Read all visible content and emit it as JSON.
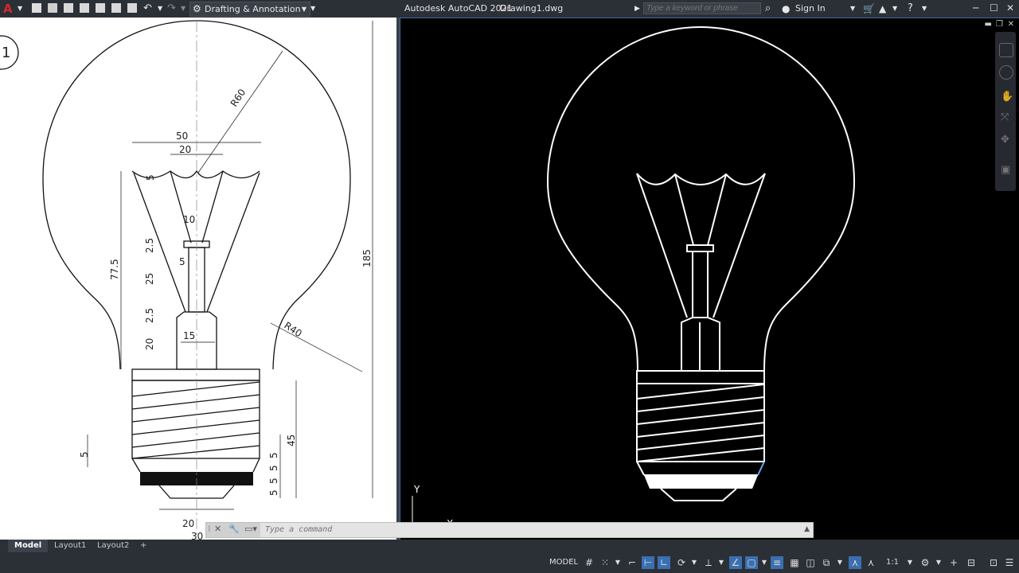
{
  "titlebar": {
    "app_title": "Autodesk AutoCAD 2021",
    "document_name": "Drawing1.dwg",
    "workspace": "Drafting & Annotation",
    "search_placeholder": "Type a keyword or phrase",
    "sign_in": "Sign In"
  },
  "reference_drawing": {
    "number": "1",
    "dims": [
      "R60",
      "50",
      "20",
      "5",
      "10",
      "2.5",
      "5",
      "77.5",
      "25",
      "2.5",
      "15",
      "20",
      "185",
      "R40",
      "45",
      "5",
      "5",
      "5",
      "5",
      "5",
      "20",
      "30"
    ]
  },
  "viewport": {
    "ucs_y": "Y",
    "ucs_x": "X"
  },
  "command_line": {
    "placeholder": "Type a command"
  },
  "layout_tabs": [
    "Model",
    "Layout1",
    "Layout2"
  ],
  "status": {
    "model": "MODEL",
    "scale": "1:1"
  },
  "colors": {
    "titlebar_bg": "#2b2f36",
    "accent_blue": "#3a6ea8",
    "drawing_line": "#ffffff",
    "canvas_bg": "#000000"
  },
  "icons": [
    "autocad-logo-icon",
    "new-icon",
    "open-icon",
    "save-icon",
    "saveas-icon",
    "plot-icon",
    "undo-icon",
    "redo-icon",
    "gear-icon",
    "search-icon",
    "user-icon",
    "cart-icon",
    "help-icon",
    "minimize-icon",
    "maximize-icon",
    "close-icon"
  ]
}
